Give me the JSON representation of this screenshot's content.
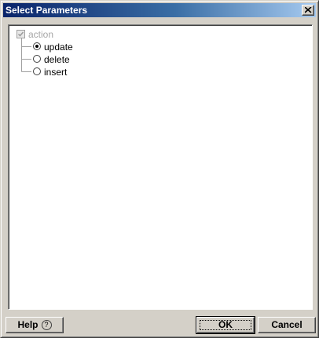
{
  "window": {
    "title": "Select Parameters"
  },
  "tree": {
    "root": {
      "label": "action",
      "checked": true,
      "disabled": true
    },
    "options": [
      {
        "label": "update",
        "selected": true
      },
      {
        "label": "delete",
        "selected": false
      },
      {
        "label": "insert",
        "selected": false
      }
    ]
  },
  "buttons": {
    "help": "Help",
    "help_icon": "?",
    "ok": "OK",
    "cancel": "Cancel"
  },
  "icons": {
    "close": "close-icon",
    "checkbox": "checkmark-icon",
    "help": "help-icon"
  }
}
